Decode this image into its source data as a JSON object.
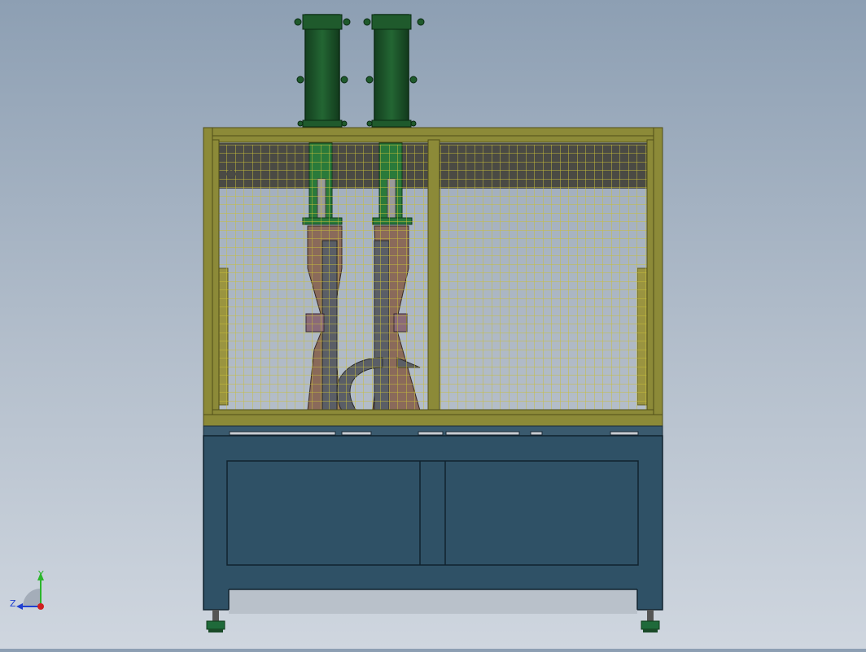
{
  "triad": {
    "y_label": "Y",
    "z_label": "Z",
    "y_color": "#2bb52b",
    "z_color": "#2040d0",
    "x_color": "#d02020"
  },
  "colors": {
    "frame": "#8c8a38",
    "frame_dark": "#5c5a20",
    "mesh": "#c8be3a",
    "cylinder": "#1f5a2c",
    "cylinder_dark": "#0f3a18",
    "cabinet": "#2f5166",
    "cabinet_dark": "#1d3646",
    "tool": "#8a6a5a",
    "guide": "#5a5e66"
  }
}
